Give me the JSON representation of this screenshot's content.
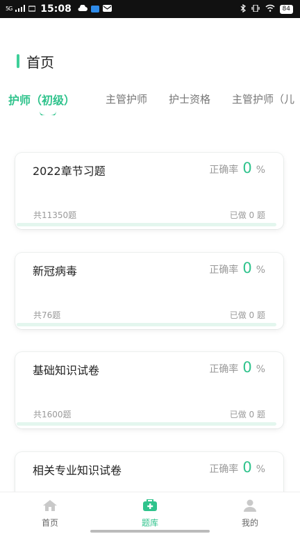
{
  "status_bar": {
    "network": "5G",
    "time": "15:08",
    "battery": "84"
  },
  "header": {
    "title": "首页"
  },
  "tabs": [
    {
      "label": "护师（初级）",
      "active": true
    },
    {
      "label": "主管护师",
      "active": false
    },
    {
      "label": "护士资格",
      "active": false
    },
    {
      "label": "主管护师（儿",
      "active": false
    }
  ],
  "cards": [
    {
      "title": "2022章节习题",
      "accuracy_label": "正确率",
      "accuracy_value": "0",
      "accuracy_unit": "%",
      "total": "共11350题",
      "done": "已做 0 题",
      "progress": 0
    },
    {
      "title": "新冠病毒",
      "accuracy_label": "正确率",
      "accuracy_value": "0",
      "accuracy_unit": "%",
      "total": "共76题",
      "done": "已做 0 题",
      "progress": 0
    },
    {
      "title": "基础知识试卷",
      "accuracy_label": "正确率",
      "accuracy_value": "0",
      "accuracy_unit": "%",
      "total": "共1600题",
      "done": "已做 0 题",
      "progress": 0
    },
    {
      "title": "相关专业知识试卷",
      "accuracy_label": "正确率",
      "accuracy_value": "0",
      "accuracy_unit": "%",
      "total": "",
      "done": "",
      "progress": 0
    }
  ],
  "bottom_nav": [
    {
      "label": "首页",
      "icon": "home-icon",
      "active": false
    },
    {
      "label": "题库",
      "icon": "medical-kit-icon",
      "active": true
    },
    {
      "label": "我的",
      "icon": "user-icon",
      "active": false
    }
  ],
  "colors": {
    "accent": "#2fc38c",
    "progress_track": "#e3f6ee"
  }
}
